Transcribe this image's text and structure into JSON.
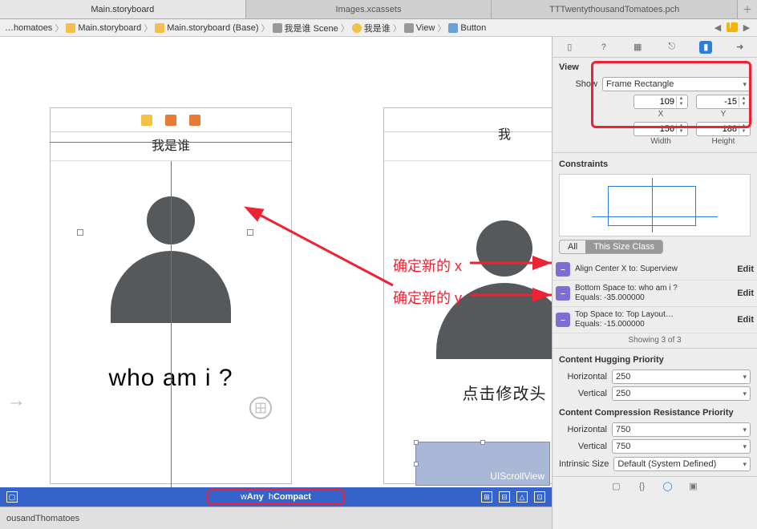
{
  "tabs": {
    "items": [
      "Main.storyboard",
      "Images.xcassets",
      "TTTwentythousandTomatoes.pch"
    ]
  },
  "breadcrumb": {
    "items": [
      "…homatoes",
      "Main.storyboard",
      "Main.storyboard (Base)",
      "我是谁 Scene",
      "我是谁",
      "View",
      "Button"
    ]
  },
  "canvas": {
    "left_title": "我是谁",
    "left_question": "who am i ?",
    "right_title": "我",
    "right_question": "点击修改头",
    "scrollview_label": "UIScrollView",
    "sizeclass_prefix_w": "w",
    "sizeclass_w": "Any",
    "sizeclass_prefix_h": "h",
    "sizeclass_h": "Compact",
    "footer_project": "ousandThomatoes"
  },
  "annotations": {
    "x_label": "确定新的 x",
    "y_label": "确定新的 y"
  },
  "inspector": {
    "view_header": "View",
    "show_label": "Show",
    "show_value": "Frame Rectangle",
    "x": "109",
    "x_lbl": "X",
    "y": "-15",
    "y_lbl": "Y",
    "w": "156",
    "w_lbl": "Width",
    "h": "188",
    "h_lbl": "Height",
    "constraints_header": "Constraints",
    "seg_all": "All",
    "seg_size": "This Size Class",
    "constraints": [
      {
        "line1": "Align Center X to:",
        "val1": "Superview",
        "line2": "",
        "val2": "",
        "edit": "Edit"
      },
      {
        "line1": "Bottom Space to:",
        "val1": "who am i ?",
        "line2": "Equals:",
        "val2": "-35.000000",
        "edit": "Edit"
      },
      {
        "line1": "Top Space to:",
        "val1": "Top Layout…",
        "line2": "Equals:",
        "val2": "-15.000000",
        "edit": "Edit"
      }
    ],
    "showing": "Showing 3 of 3",
    "hug_header": "Content Hugging Priority",
    "hug_h_lbl": "Horizontal",
    "hug_h": "250",
    "hug_v_lbl": "Vertical",
    "hug_v": "250",
    "crp_header": "Content Compression Resistance Priority",
    "crp_h_lbl": "Horizontal",
    "crp_h": "750",
    "crp_v_lbl": "Vertical",
    "crp_v": "750",
    "intrinsic_lbl": "Intrinsic Size",
    "intrinsic_val": "Default (System Defined)"
  }
}
